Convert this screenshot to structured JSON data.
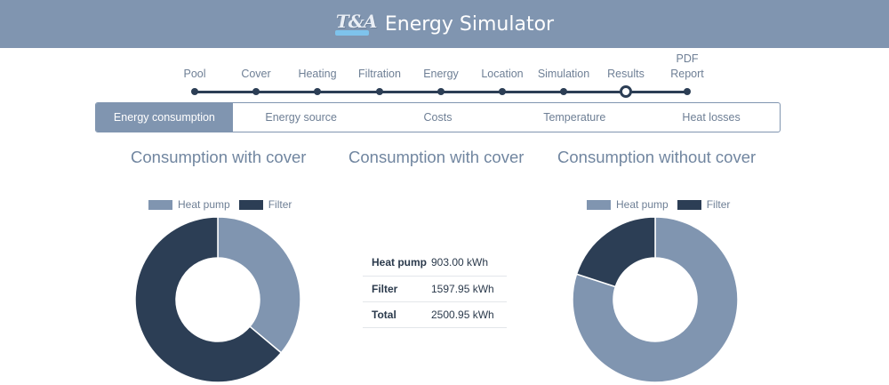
{
  "header": {
    "logo_text": "T&A",
    "title": "Energy Simulator"
  },
  "stepper": {
    "steps": [
      {
        "label": "Pool"
      },
      {
        "label": "Cover"
      },
      {
        "label": "Heating"
      },
      {
        "label": "Filtration"
      },
      {
        "label": "Energy"
      },
      {
        "label": "Location"
      },
      {
        "label": "Simulation"
      },
      {
        "label": "Results",
        "active": true
      },
      {
        "label": "PDF Report"
      }
    ]
  },
  "tabs": [
    {
      "label": "Energy consumption",
      "active": true
    },
    {
      "label": "Energy source"
    },
    {
      "label": "Costs"
    },
    {
      "label": "Temperature"
    },
    {
      "label": "Heat losses"
    }
  ],
  "colors": {
    "heat_pump": "#8095b0",
    "filter": "#2c3e55",
    "accent": "#8095b0"
  },
  "panels": {
    "left": {
      "title": "Consumption with cover",
      "legend": [
        "Heat pump",
        "Filter"
      ],
      "slices": [
        {
          "name": "Heat pump",
          "value": 903.0
        },
        {
          "name": "Filter",
          "value": 1597.95
        }
      ]
    },
    "middle": {
      "title": "Consumption with cover",
      "table": [
        {
          "label": "Heat pump",
          "value": "903.00 kWh"
        },
        {
          "label": "Filter",
          "value": "1597.95 kWh"
        },
        {
          "label": "Total",
          "value": "2500.95 kWh"
        }
      ]
    },
    "right": {
      "title": "Consumption without cover",
      "legend": [
        "Heat pump",
        "Filter"
      ],
      "slices": [
        {
          "name": "Heat pump",
          "value": 0.8
        },
        {
          "name": "Filter",
          "value": 0.2
        }
      ]
    }
  },
  "chart_data": [
    {
      "type": "pie",
      "title": "Consumption with cover",
      "categories": [
        "Heat pump",
        "Filter"
      ],
      "values": [
        903.0,
        1597.95
      ],
      "legend": "top"
    },
    {
      "type": "pie",
      "title": "Consumption without cover",
      "categories": [
        "Heat pump",
        "Filter"
      ],
      "values": [
        0.8,
        0.2
      ],
      "legend": "top"
    }
  ]
}
